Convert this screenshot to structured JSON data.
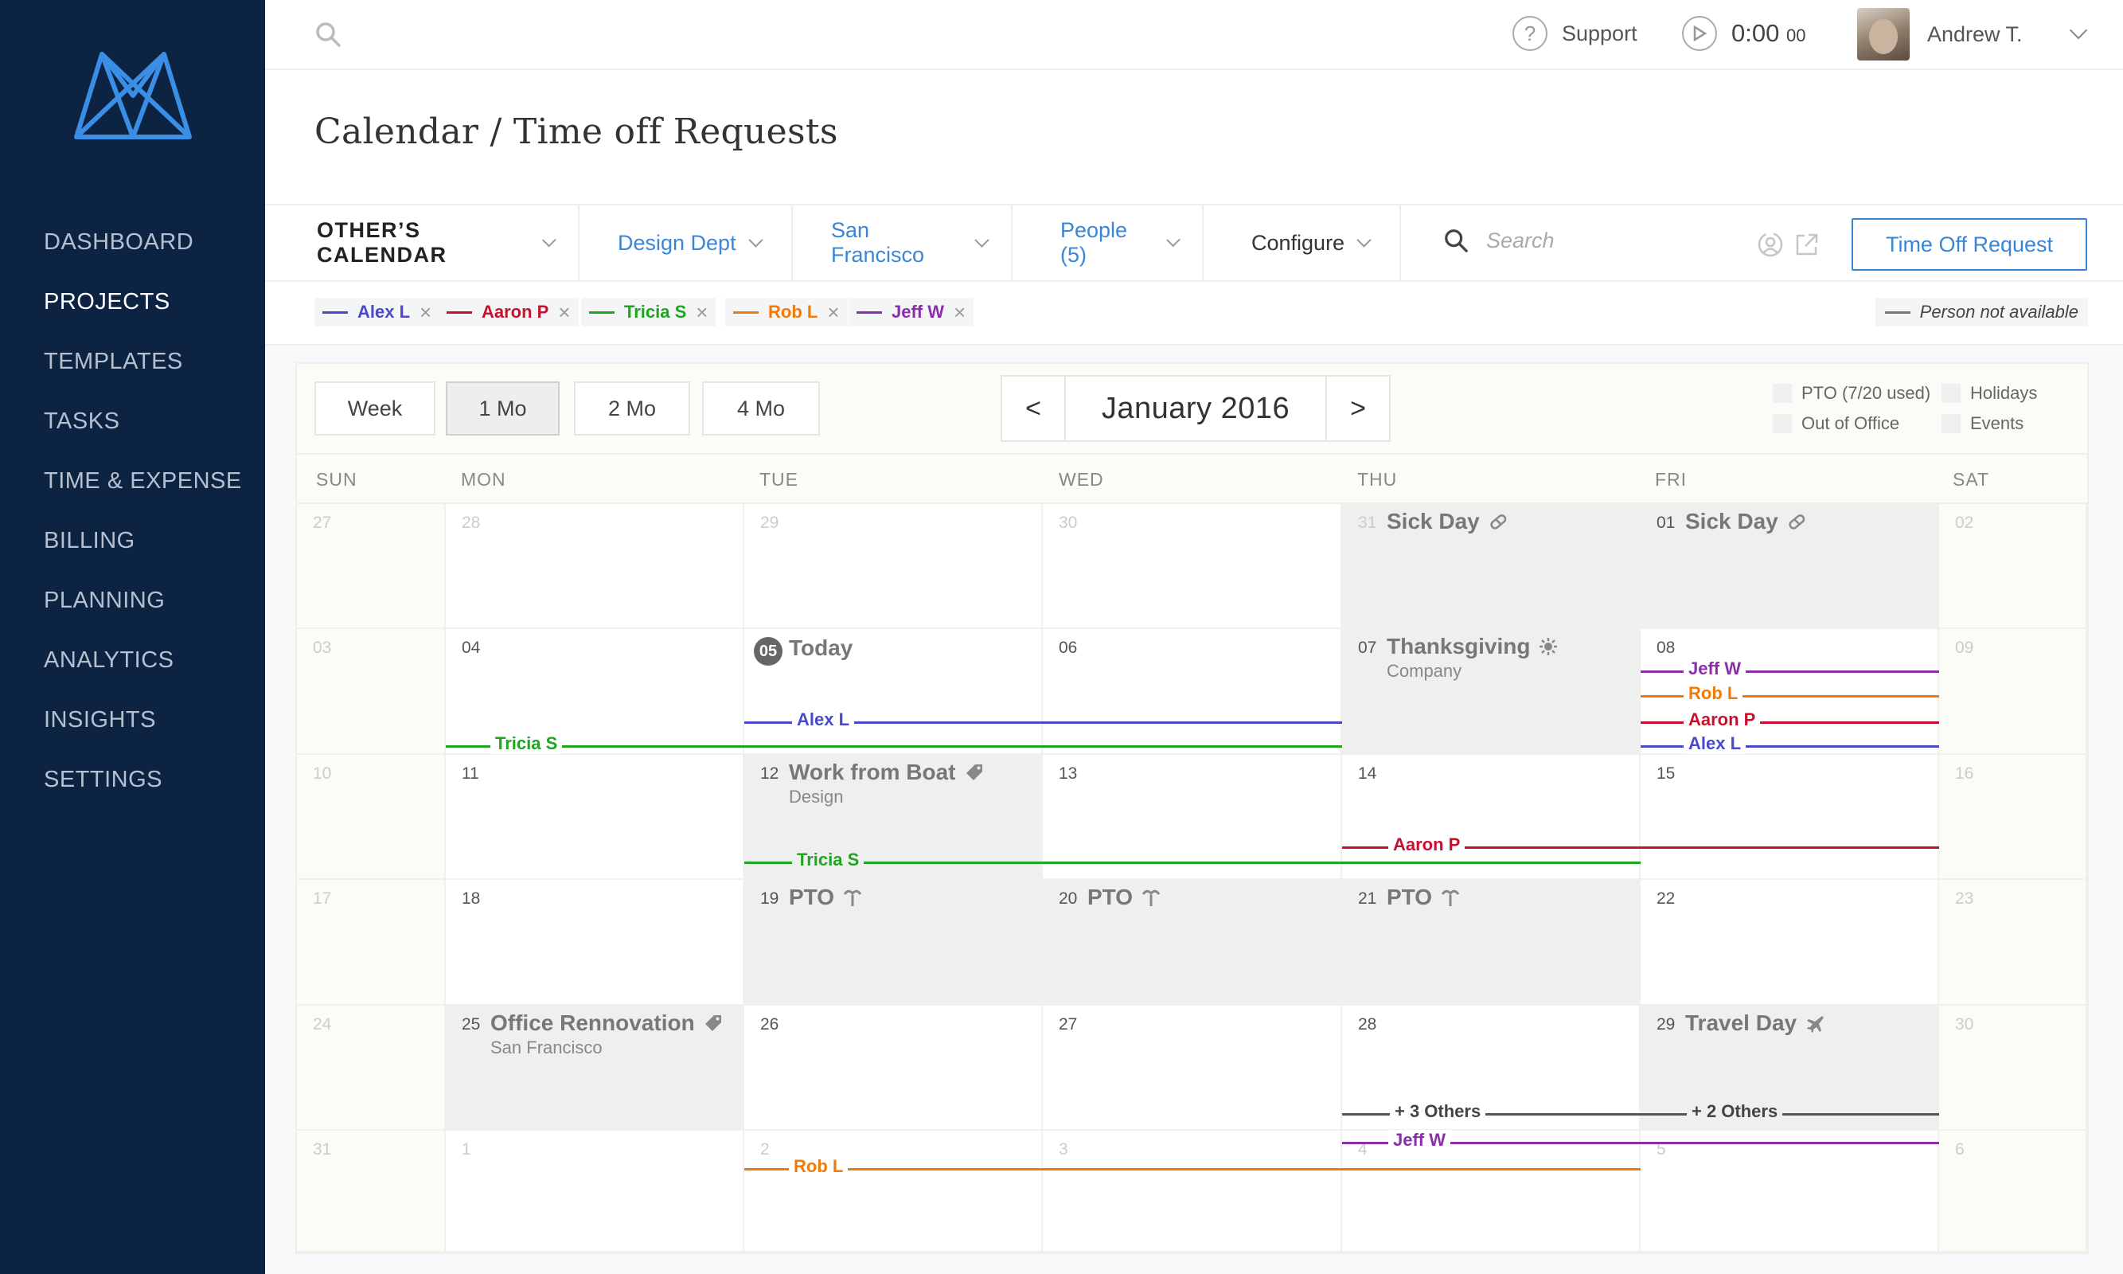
{
  "sidebar": {
    "items": [
      {
        "label": "DASHBOARD"
      },
      {
        "label": "PROJECTS"
      },
      {
        "label": "TEMPLATES"
      },
      {
        "label": "TASKS"
      },
      {
        "label": "TIME & EXPENSE"
      },
      {
        "label": "BILLING"
      },
      {
        "label": "PLANNING"
      },
      {
        "label": "ANALYTICS"
      },
      {
        "label": "INSIGHTS"
      },
      {
        "label": "SETTINGS"
      }
    ],
    "active": "PROJECTS"
  },
  "topbar": {
    "support_label": "Support",
    "timer_main": "0:00",
    "timer_small": "00",
    "user_name": "Andrew T."
  },
  "page": {
    "title": "Calendar / Time off Requests"
  },
  "filters": {
    "calendar": "OTHER’S CALENDAR",
    "dept": "Design Dept",
    "location": "San Francisco",
    "people": "People (5)",
    "configure": "Configure",
    "search_placeholder": "Search",
    "time_off_button": "Time Off Request"
  },
  "chips": [
    {
      "label": "Alex L",
      "color": "#4a4ac8"
    },
    {
      "label": "Aaron P",
      "color": "#c8102e"
    },
    {
      "label": "Tricia S",
      "color": "#1fa51f"
    },
    {
      "label": "Rob L",
      "color": "#f07a0a"
    },
    {
      "label": "Jeff W",
      "color": "#8a2fa8"
    }
  ],
  "legend_not_available": "Person not available",
  "calendar": {
    "ranges": [
      "Week",
      "1 Mo",
      "2 Mo",
      "4 Mo"
    ],
    "active_range": "1 Mo",
    "prev": "<",
    "next": ">",
    "month_label": "January 2016",
    "legend": [
      "PTO (7/20 used)",
      "Holidays",
      "Out of Office",
      "Events"
    ],
    "days_of_week": [
      "SUN",
      "MON",
      "TUE",
      "WED",
      "THU",
      "FRI",
      "SAT"
    ],
    "weeks": [
      [
        "27",
        "28",
        "29",
        "30",
        "31",
        "01",
        "02"
      ],
      [
        "03",
        "04",
        "05",
        "06",
        "07",
        "08",
        "09"
      ],
      [
        "10",
        "11",
        "12",
        "13",
        "14",
        "15",
        "16"
      ],
      [
        "17",
        "18",
        "19",
        "20",
        "21",
        "22",
        "23"
      ],
      [
        "24",
        "25",
        "26",
        "27",
        "28",
        "29",
        "30"
      ],
      [
        "31",
        "1",
        "2",
        "3",
        "4",
        "5",
        "6"
      ]
    ],
    "events": {
      "sick1": {
        "title": "Sick Day"
      },
      "sick2": {
        "title": "Sick Day"
      },
      "today": {
        "title": "Today"
      },
      "thanksgiving": {
        "title": "Thanksgiving",
        "sub": "Company"
      },
      "boat": {
        "title": "Work from Boat",
        "sub": "Design"
      },
      "pto19": {
        "title": "PTO"
      },
      "pto20": {
        "title": "PTO"
      },
      "pto21": {
        "title": "PTO"
      },
      "reno": {
        "title": "Office Rennovation",
        "sub": "San Francisco"
      },
      "travel": {
        "title": "Travel Day"
      }
    },
    "bars": {
      "jeff_w_1": "Jeff W",
      "rob_l_1": "Rob L",
      "aaron_p_1": "Aaron P",
      "alex_l_1": "Alex L",
      "alex_l_2": "Alex L",
      "tricia_s_1": "Tricia S",
      "tricia_s_2": "Tricia S",
      "aaron_p_2": "Aaron P",
      "others_3": "+ 3 Others",
      "others_2": "+ 2 Others",
      "jeff_w_2": "Jeff W",
      "rob_l_2": "Rob L"
    }
  }
}
